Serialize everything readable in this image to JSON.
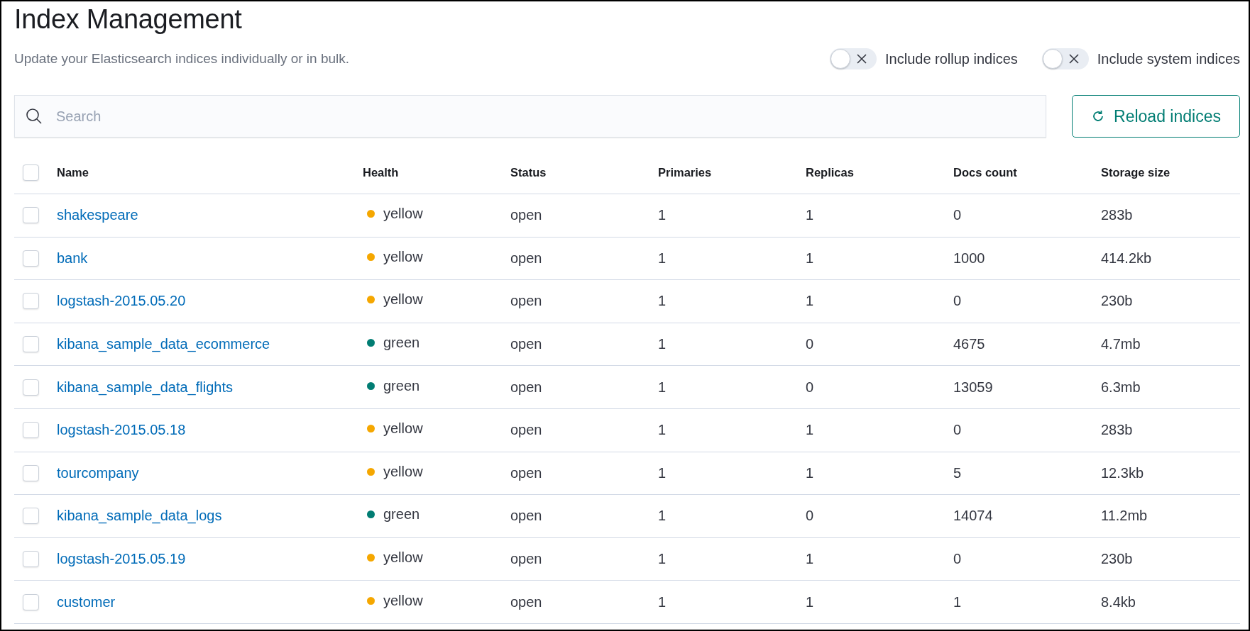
{
  "header": {
    "title": "Index Management",
    "description": "Update your Elasticsearch indices individually or in bulk."
  },
  "toggles": [
    {
      "label": "Include rollup indices",
      "on": false
    },
    {
      "label": "Include system indices",
      "on": false
    }
  ],
  "search": {
    "placeholder": "Search"
  },
  "reload_button": "Reload indices",
  "table": {
    "select_all_checked": false,
    "columns": [
      "Name",
      "Health",
      "Status",
      "Primaries",
      "Replicas",
      "Docs count",
      "Storage size"
    ],
    "rows": [
      {
        "checked": false,
        "name": "shakespeare",
        "health": "yellow",
        "color": "#f5a700",
        "status": "open",
        "primaries": "1",
        "replicas": "1",
        "docs": "0",
        "size": "283b"
      },
      {
        "checked": false,
        "name": "bank",
        "health": "yellow",
        "color": "#f5a700",
        "status": "open",
        "primaries": "1",
        "replicas": "1",
        "docs": "1000",
        "size": "414.2kb"
      },
      {
        "checked": false,
        "name": "logstash-2015.05.20",
        "health": "yellow",
        "color": "#f5a700",
        "status": "open",
        "primaries": "1",
        "replicas": "1",
        "docs": "0",
        "size": "230b"
      },
      {
        "checked": false,
        "name": "kibana_sample_data_ecommerce",
        "health": "green",
        "color": "#017d73",
        "status": "open",
        "primaries": "1",
        "replicas": "0",
        "docs": "4675",
        "size": "4.7mb"
      },
      {
        "checked": false,
        "name": "kibana_sample_data_flights",
        "health": "green",
        "color": "#017d73",
        "status": "open",
        "primaries": "1",
        "replicas": "0",
        "docs": "13059",
        "size": "6.3mb"
      },
      {
        "checked": false,
        "name": "logstash-2015.05.18",
        "health": "yellow",
        "color": "#f5a700",
        "status": "open",
        "primaries": "1",
        "replicas": "1",
        "docs": "0",
        "size": "283b"
      },
      {
        "checked": false,
        "name": "tourcompany",
        "health": "yellow",
        "color": "#f5a700",
        "status": "open",
        "primaries": "1",
        "replicas": "1",
        "docs": "5",
        "size": "12.3kb"
      },
      {
        "checked": false,
        "name": "kibana_sample_data_logs",
        "health": "green",
        "color": "#017d73",
        "status": "open",
        "primaries": "1",
        "replicas": "0",
        "docs": "14074",
        "size": "11.2mb"
      },
      {
        "checked": false,
        "name": "logstash-2015.05.19",
        "health": "yellow",
        "color": "#f5a700",
        "status": "open",
        "primaries": "1",
        "replicas": "1",
        "docs": "0",
        "size": "230b"
      },
      {
        "checked": false,
        "name": "customer",
        "health": "yellow",
        "color": "#f5a700",
        "status": "open",
        "primaries": "1",
        "replicas": "1",
        "docs": "1",
        "size": "8.4kb"
      }
    ]
  }
}
